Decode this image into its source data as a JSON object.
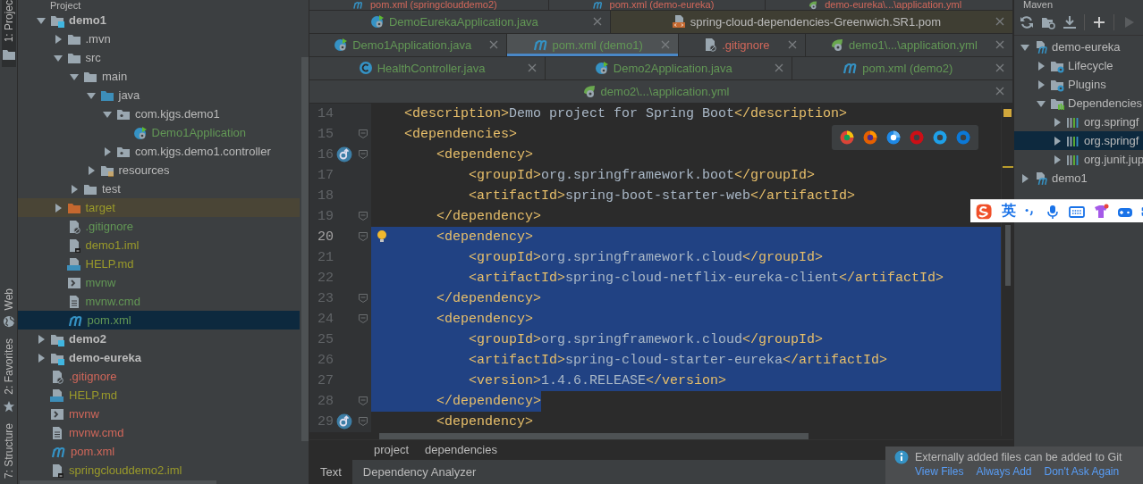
{
  "tool_strip": {
    "top": [
      {
        "label": "1: Projec",
        "kind": "folder",
        "selected": true
      }
    ],
    "bottom": [
      {
        "label": "Web",
        "kind": "globe",
        "selected": false
      },
      {
        "label": "2: Favorites",
        "kind": "star",
        "selected": false
      },
      {
        "label": "7: Structure",
        "kind": "none",
        "selected": false
      }
    ]
  },
  "project_panel": {
    "title": "Project",
    "tree": [
      {
        "name": "demo1",
        "kind": "module",
        "color": "#bbbbbb",
        "expanded": true,
        "selected": false,
        "children": [
          {
            "name": ".mvn",
            "kind": "folder",
            "color": "#bbbbbb",
            "expanded": false,
            "selected": false
          },
          {
            "name": "src",
            "kind": "folder",
            "color": "#bbbbbb",
            "expanded": true,
            "selected": false,
            "children": [
              {
                "name": "main",
                "kind": "folder",
                "color": "#bbbbbb",
                "expanded": true,
                "selected": false,
                "children": [
                  {
                    "name": "java",
                    "kind": "source-folder",
                    "color": "#bbbbbb",
                    "expanded": true,
                    "selected": false,
                    "children": [
                      {
                        "name": "com.kjgs.demo1",
                        "kind": "package",
                        "color": "#bbbbbb",
                        "expanded": true,
                        "selected": false,
                        "children": [
                          {
                            "name": "Demo1Application",
                            "kind": "spring-class",
                            "color": "#629755",
                            "selected": false
                          }
                        ]
                      },
                      {
                        "name": "com.kjgs.demo1.controller",
                        "kind": "package",
                        "color": "#bbbbbb",
                        "expanded": false,
                        "selected": false
                      }
                    ]
                  },
                  {
                    "name": "resources",
                    "kind": "resources",
                    "color": "#bbbbbb",
                    "expanded": false,
                    "selected": false
                  }
                ]
              },
              {
                "name": "test",
                "kind": "folder",
                "color": "#bbbbbb",
                "expanded": false,
                "selected": false
              }
            ]
          },
          {
            "name": "target",
            "kind": "excluded",
            "color": "#9a9a2a",
            "expanded": false,
            "selected": false
          },
          {
            "name": ".gitignore",
            "kind": "ignore-file",
            "color": "#629755",
            "selected": false
          },
          {
            "name": "demo1.iml",
            "kind": "iml",
            "color": "#9a9a2a",
            "selected": false
          },
          {
            "name": "HELP.md",
            "kind": "md",
            "color": "#9a9a2a",
            "selected": false
          },
          {
            "name": "mvnw",
            "kind": "shell",
            "color": "#629755",
            "selected": false
          },
          {
            "name": "mvnw.cmd",
            "kind": "text",
            "color": "#629755",
            "selected": false
          },
          {
            "name": "pom.xml",
            "kind": "maven",
            "color": "#629755",
            "selected": true
          }
        ]
      },
      {
        "name": "demo2",
        "kind": "module",
        "color": "#bbbbbb",
        "expanded": false,
        "selected": false
      },
      {
        "name": "demo-eureka",
        "kind": "module",
        "color": "#bbbbbb",
        "expanded": false,
        "selected": false
      },
      {
        "name": ".gitignore",
        "kind": "ignore-file",
        "color": "#d1675a",
        "selected": false
      },
      {
        "name": "HELP.md",
        "kind": "md",
        "color": "#9a9a2a",
        "selected": false
      },
      {
        "name": "mvnw",
        "kind": "shell",
        "color": "#d1675a",
        "selected": false
      },
      {
        "name": "mvnw.cmd",
        "kind": "text",
        "color": "#d1675a",
        "selected": false
      },
      {
        "name": "pom.xml",
        "kind": "maven",
        "color": "#d1675a",
        "selected": false
      },
      {
        "name": "springclouddemo2.iml",
        "kind": "iml",
        "color": "#9a9a2a",
        "selected": false
      }
    ]
  },
  "editor": {
    "tab_rows": [
      [
        {
          "label": "pom.xml (springclouddemo2)",
          "kind": "maven",
          "color": "#d1675a",
          "selected": false
        },
        {
          "label": "pom.xml (demo-eureka)",
          "kind": "maven",
          "color": "#d1675a",
          "selected": false
        },
        {
          "label": "demo-eureka\\...\\application.yml",
          "kind": "yml",
          "color": "#d1675a",
          "selected": false
        }
      ],
      [
        {
          "label": "DemoEurekaApplication.java",
          "kind": "spring-class",
          "color": "#629755",
          "selected": false
        },
        {
          "label": "spring-cloud-dependencies-Greenwich.SR1.pom",
          "kind": "library-pom",
          "color": "#bbbbbb",
          "selected": false
        }
      ],
      [
        {
          "label": "Demo1Application.java",
          "kind": "spring-class",
          "color": "#629755",
          "selected": false
        },
        {
          "label": "pom.xml (demo1)",
          "kind": "maven",
          "color": "#629755",
          "selected": true
        },
        {
          "label": ".gitignore",
          "kind": "ignore-file",
          "color": "#d1675a",
          "selected": false
        },
        {
          "label": "demo1\\...\\application.yml",
          "kind": "yml",
          "color": "#629755",
          "selected": false
        }
      ],
      [
        {
          "label": "HealthController.java",
          "kind": "class",
          "color": "#629755",
          "selected": false
        },
        {
          "label": "Demo2Application.java",
          "kind": "spring-class",
          "color": "#629755",
          "selected": false
        },
        {
          "label": "pom.xml (demo2)",
          "kind": "maven",
          "color": "#629755",
          "selected": false
        }
      ],
      [
        {
          "label": "demo2\\...\\application.yml",
          "kind": "yml",
          "color": "#629755",
          "selected": false
        }
      ]
    ],
    "lines": [
      {
        "number": "14",
        "text": "    <description>Demo project for Spring Boot</description>",
        "fold": false,
        "gutter_icon": false,
        "bulb": false,
        "current": false,
        "selected": false
      },
      {
        "number": "15",
        "text": "    <dependencies>",
        "fold": true,
        "gutter_icon": false,
        "bulb": false,
        "current": false,
        "selected": false
      },
      {
        "number": "16",
        "text": "        <dependency>",
        "fold": true,
        "gutter_icon": true,
        "bulb": false,
        "current": false,
        "selected": false
      },
      {
        "number": "17",
        "text": "            <groupId>org.springframework.boot</groupId>",
        "fold": false,
        "gutter_icon": false,
        "bulb": false,
        "current": false,
        "selected": false
      },
      {
        "number": "18",
        "text": "            <artifactId>spring-boot-starter-web</artifactId>",
        "fold": false,
        "gutter_icon": false,
        "bulb": false,
        "current": false,
        "selected": false
      },
      {
        "number": "19",
        "text": "        </dependency>",
        "fold": true,
        "gutter_icon": false,
        "bulb": false,
        "current": false,
        "selected": false
      },
      {
        "number": "20",
        "text": "        <dependency>",
        "fold": true,
        "gutter_icon": false,
        "bulb": true,
        "current": true,
        "selected": true
      },
      {
        "number": "21",
        "text": "            <groupId>org.springframework.cloud</groupId>",
        "fold": false,
        "gutter_icon": false,
        "bulb": false,
        "current": false,
        "selected": true
      },
      {
        "number": "22",
        "text": "            <artifactId>spring-cloud-netflix-eureka-client</artifactId>",
        "fold": false,
        "gutter_icon": false,
        "bulb": false,
        "current": false,
        "selected": true
      },
      {
        "number": "23",
        "text": "        </dependency>",
        "fold": true,
        "gutter_icon": false,
        "bulb": false,
        "current": false,
        "selected": true
      },
      {
        "number": "24",
        "text": "        <dependency>",
        "fold": true,
        "gutter_icon": false,
        "bulb": false,
        "current": false,
        "selected": true
      },
      {
        "number": "25",
        "text": "            <groupId>org.springframework.cloud</groupId>",
        "fold": false,
        "gutter_icon": false,
        "bulb": false,
        "current": false,
        "selected": true
      },
      {
        "number": "26",
        "text": "            <artifactId>spring-cloud-starter-eureka</artifactId>",
        "fold": false,
        "gutter_icon": false,
        "bulb": false,
        "current": false,
        "selected": true
      },
      {
        "number": "27",
        "text": "            <version>1.4.6.RELEASE</version>",
        "fold": false,
        "gutter_icon": false,
        "bulb": false,
        "current": false,
        "selected": true
      },
      {
        "number": "28",
        "text": "        </dependency>",
        "fold": true,
        "gutter_icon": false,
        "bulb": false,
        "current": false,
        "selected": true
      },
      {
        "number": "29",
        "text": "        <dependency>",
        "fold": true,
        "gutter_icon": true,
        "bulb": false,
        "current": false,
        "selected": false
      }
    ],
    "breadcrumb": [
      "project",
      "dependencies"
    ],
    "bottom_tabs": [
      {
        "label": "Text",
        "selected": true
      },
      {
        "label": "Dependency Analyzer",
        "selected": false
      }
    ]
  },
  "maven_panel": {
    "title": "Maven",
    "tree": [
      {
        "name": "demo-eureka",
        "kind": "maven-module",
        "expanded": true,
        "selected": false,
        "children": [
          {
            "name": "Lifecycle",
            "kind": "gear-folder",
            "expanded": false,
            "selected": false
          },
          {
            "name": "Plugins",
            "kind": "gear-folder",
            "expanded": false,
            "selected": false
          },
          {
            "name": "Dependencies",
            "kind": "lib-folder",
            "expanded": true,
            "selected": false,
            "children": [
              {
                "name": "org.springf",
                "kind": "library",
                "expanded": false,
                "selected": false
              },
              {
                "name": "org.springf",
                "kind": "library",
                "expanded": false,
                "selected": true
              },
              {
                "name": "org.junit.jup",
                "kind": "library",
                "expanded": false,
                "selected": false
              }
            ]
          }
        ]
      },
      {
        "name": "demo1",
        "kind": "maven-module",
        "expanded": false,
        "selected": false
      }
    ]
  },
  "ime_bar": {
    "label": "英"
  },
  "notification": {
    "message": "Externally added files can be added to Git",
    "links": [
      "View Files",
      "Always Add",
      "Don't Ask Again"
    ]
  }
}
